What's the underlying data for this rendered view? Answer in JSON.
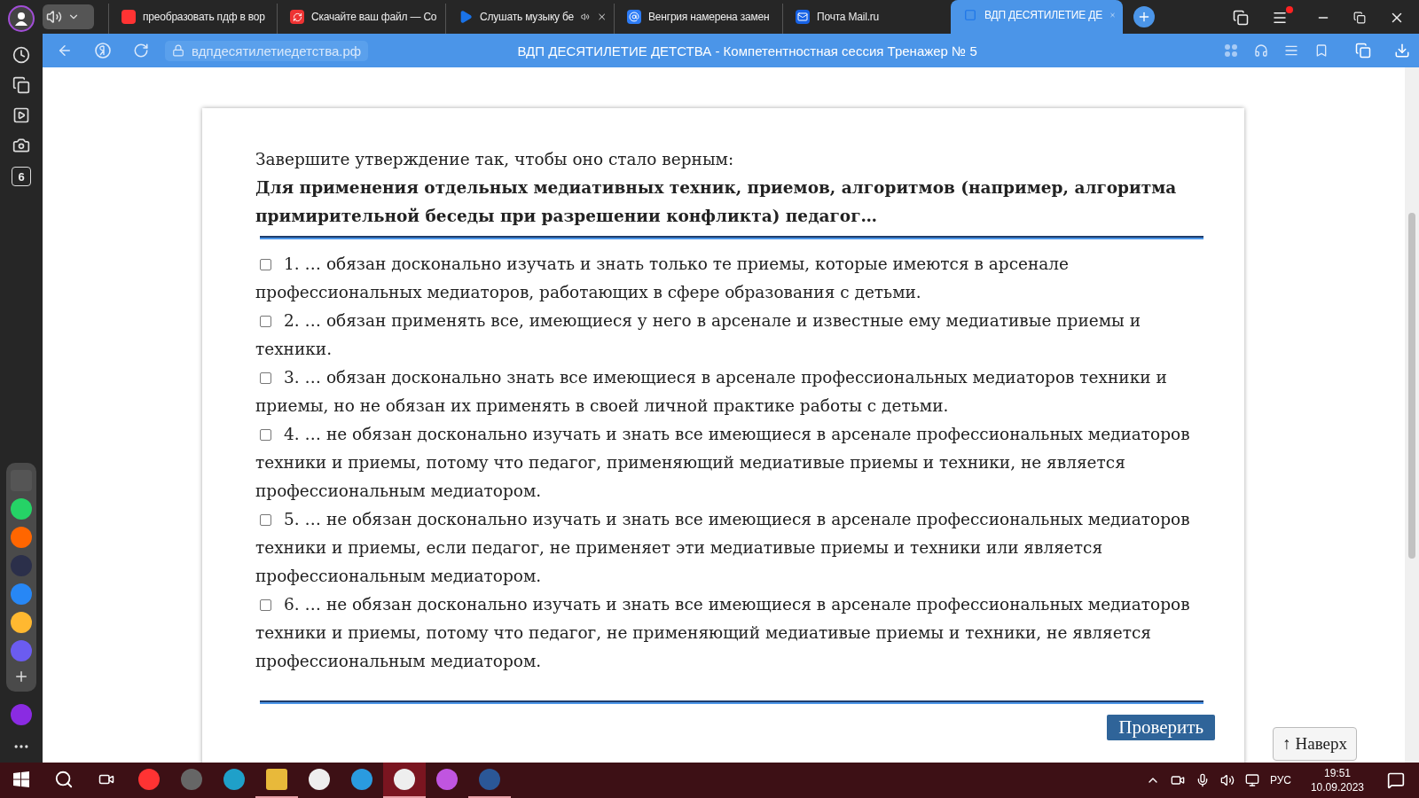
{
  "browser": {
    "tabs": [
      {
        "title": "преобразовать пдф в вор",
        "kind": "search",
        "selected": false,
        "audio": false
      },
      {
        "title": "Скачайте ваш файл — Со",
        "kind": "convert",
        "selected": false,
        "audio": false
      },
      {
        "title": "Слушать музыку бе",
        "kind": "play",
        "selected": false,
        "audio": true
      },
      {
        "title": "Венгрия намерена замен",
        "kind": "news",
        "selected": false,
        "audio": false
      },
      {
        "title": "Почта Mail.ru",
        "kind": "mail",
        "selected": false,
        "audio": false
      },
      {
        "title": "ВДП ДЕСЯТИЛЕТИЕ ДЕ",
        "kind": "site",
        "selected": true,
        "audio": false
      }
    ],
    "address": "вдпдесятилетиедетства.рф",
    "page_title": "ВДП ДЕСЯТИЛЕТИЕ ДЕТСТВА - Компетентностная сессия Тренажер № 5",
    "sidebar_counter": "6"
  },
  "question": {
    "prompt": "Завершите утверждение так, чтобы оно стало верным:",
    "statement": "Для применения отдельных медиативных техник, приемов, алгоритмов (например, алгоритма примирительной беседы при разрешении конфликта) педагог…",
    "options": [
      {
        "text": "1. … обязан досконально изучать и знать только те приемы, которые имеются в арсенале профессиональных медиаторов, работающих в сфере образования с детьми.",
        "checked": false
      },
      {
        "text": "2. … обязан применять все, имеющиеся у него в арсенале и известные ему медиативые приемы и техники.",
        "checked": false
      },
      {
        "text": "3. … обязан досконально знать все имеющиеся в арсенале профессиональных медиаторов техники и приемы, но не обязан их применять в своей личной практике работы с детьми.",
        "checked": false
      },
      {
        "text": "4. … не обязан досконально изучать и знать все имеющиеся в арсенале профессиональных медиаторов техники и приемы, потому что педагог, применяющий медиативые приемы и техники, не является профессиональным медиатором.",
        "checked": false
      },
      {
        "text": "5. … не обязан досконально изучать и знать все имеющиеся в арсенале профессиональных медиаторов техники и приемы, если педагог, не применяет эти медиативые приемы и техники или является профессиональным медиатором.",
        "checked": false
      },
      {
        "text": "6. … не обязан досконально изучать и знать все имеющиеся в арсенале профессиональных медиаторов техники и приемы, потому что педагог, не применяющий медиативые приемы и техники, не является профессиональным медиатором.",
        "checked": false
      }
    ],
    "check_button": "Проверить"
  },
  "top_button": "↑ Наверх",
  "taskbar": {
    "apps": [
      {
        "kind": "yandex",
        "selected": false,
        "running": false
      },
      {
        "kind": "game",
        "selected": false,
        "running": false
      },
      {
        "kind": "edge",
        "selected": false,
        "running": false
      },
      {
        "kind": "folder",
        "selected": false,
        "running": true
      },
      {
        "kind": "store",
        "selected": false,
        "running": false
      },
      {
        "kind": "mail",
        "selected": false,
        "running": false
      },
      {
        "kind": "browser",
        "selected": true,
        "running": true
      },
      {
        "kind": "gem",
        "selected": false,
        "running": false
      },
      {
        "kind": "word",
        "selected": false,
        "running": true
      }
    ],
    "language": "РУС",
    "time": "19:51",
    "date": "10.09.2023"
  }
}
